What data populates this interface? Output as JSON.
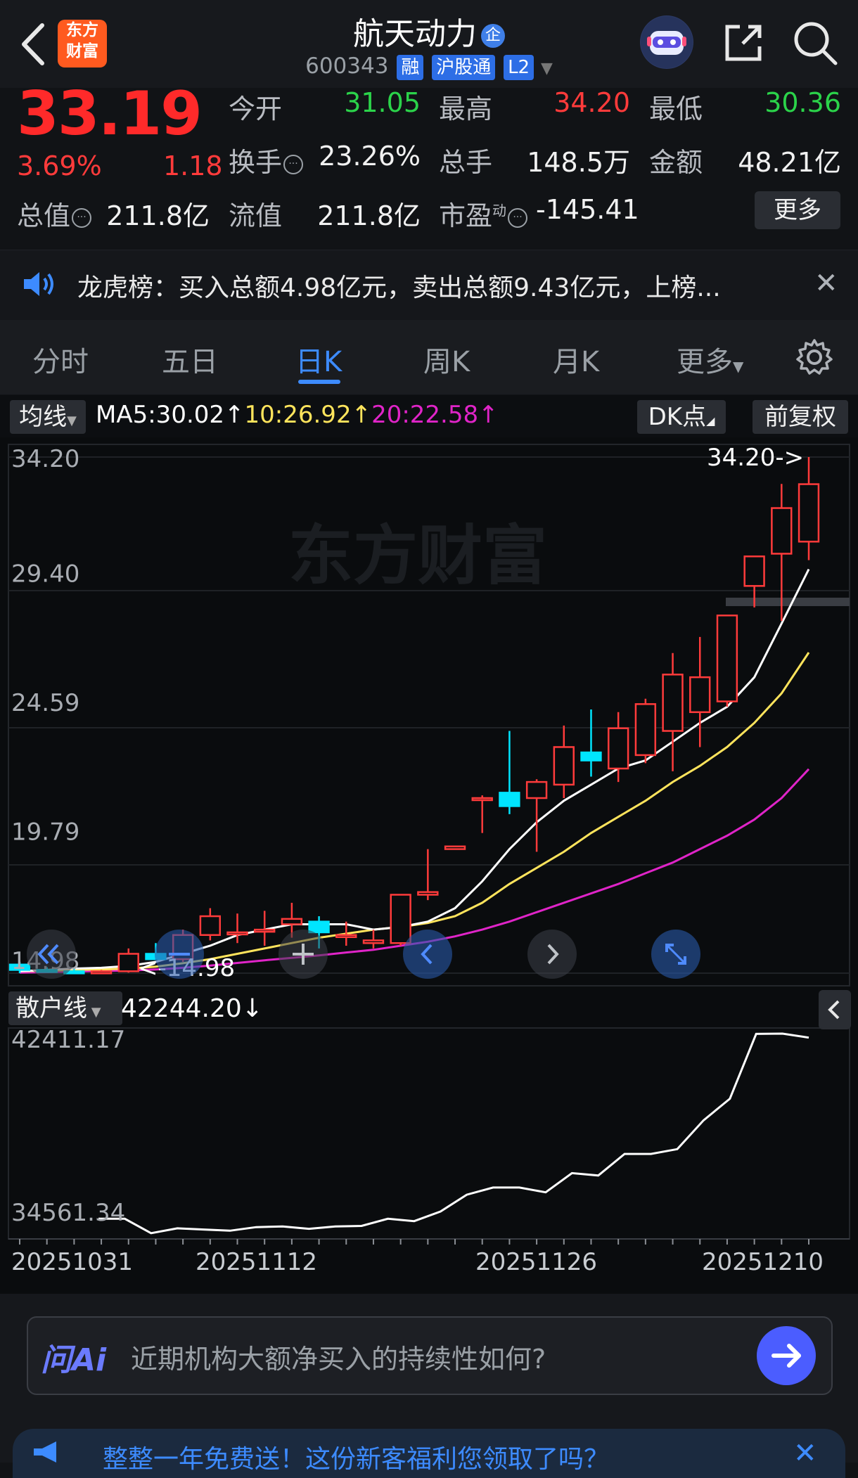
{
  "header": {
    "stock_name": "航天动力",
    "badge": "企",
    "code": "600343",
    "tags": [
      "融",
      "沪股通",
      "L2"
    ]
  },
  "quote": {
    "price": "33.19",
    "change_pct": "3.69%",
    "change": "1.18",
    "fields": [
      {
        "label": "今开",
        "value": "31.05",
        "color": "green"
      },
      {
        "label": "最高",
        "value": "34.20",
        "color": "red"
      },
      {
        "label": "最低",
        "value": "30.36",
        "color": "green"
      },
      {
        "label": "换手",
        "value": "23.26%",
        "color": "white"
      },
      {
        "label": "总手",
        "value": "148.5万",
        "color": "white"
      },
      {
        "label": "金额",
        "value": "48.21亿",
        "color": "white"
      },
      {
        "label": "总值",
        "value": "211.8亿",
        "color": "white"
      },
      {
        "label": "流值",
        "value": "211.8亿",
        "color": "white"
      },
      {
        "label": "市盈",
        "value": "-145.41",
        "color": "white"
      }
    ],
    "pe_superscript": "动",
    "more_label": "更多"
  },
  "news": {
    "text": "龙虎榜：买入总额4.98亿元，卖出总额9.43亿元，上榜..."
  },
  "tabs": [
    "分时",
    "五日",
    "日K",
    "周K",
    "月K",
    "更多"
  ],
  "active_tab": "日K",
  "ma_row": {
    "selector": "均线",
    "ma5": "MA5:30.02↑",
    "ma10": "10:26.92↑",
    "ma20": "20:22.58↑",
    "dk_label": "DK点",
    "adjust_label": "前复权"
  },
  "colors": {
    "up": "#ff3b3b",
    "down": "#00e5ff",
    "ma5": "#ffffff",
    "ma10": "#ffe45c",
    "ma20": "#e024c8",
    "accent": "#3d8bff"
  },
  "chart_data": [
    {
      "type": "candlestick",
      "title": "",
      "y_ticks": [
        "34.20",
        "29.40",
        "24.59",
        "19.79",
        "14.98"
      ],
      "ylim": [
        14.98,
        34.2
      ],
      "x_labels": [
        "20251031",
        "20251112",
        "20251126",
        "20251210"
      ],
      "annotations": {
        "high": "34.20->",
        "low": "<-14.98"
      },
      "candles": [
        {
          "o": 15.3,
          "h": 15.4,
          "l": 14.98,
          "c": 15.1
        },
        {
          "o": 15.1,
          "h": 15.2,
          "l": 15.0,
          "c": 15.05
        },
        {
          "o": 15.05,
          "h": 15.15,
          "l": 14.95,
          "c": 15.0
        },
        {
          "o": 15.0,
          "h": 15.1,
          "l": 14.95,
          "c": 15.05
        },
        {
          "o": 15.05,
          "h": 15.9,
          "l": 15.0,
          "c": 15.7
        },
        {
          "o": 15.7,
          "h": 16.1,
          "l": 15.5,
          "c": 15.5
        },
        {
          "o": 15.5,
          "h": 16.6,
          "l": 15.4,
          "c": 16.4
        },
        {
          "o": 16.4,
          "h": 17.4,
          "l": 16.2,
          "c": 17.1
        },
        {
          "o": 16.5,
          "h": 17.2,
          "l": 16.1,
          "c": 16.5
        },
        {
          "o": 16.6,
          "h": 17.3,
          "l": 16.0,
          "c": 16.6
        },
        {
          "o": 16.8,
          "h": 17.6,
          "l": 16.3,
          "c": 17.0
        },
        {
          "o": 16.9,
          "h": 17.1,
          "l": 15.9,
          "c": 16.5
        },
        {
          "o": 16.4,
          "h": 16.9,
          "l": 16.0,
          "c": 16.4
        },
        {
          "o": 16.1,
          "h": 16.6,
          "l": 15.9,
          "c": 16.2
        },
        {
          "o": 16.1,
          "h": 17.9,
          "l": 16.0,
          "c": 17.9
        },
        {
          "o": 17.9,
          "h": 19.6,
          "l": 17.7,
          "c": 18.0
        },
        {
          "o": 19.6,
          "h": 19.7,
          "l": 19.6,
          "c": 19.7
        },
        {
          "o": 21.5,
          "h": 21.6,
          "l": 20.2,
          "c": 21.5
        },
        {
          "o": 21.7,
          "h": 24.0,
          "l": 20.9,
          "c": 21.2
        },
        {
          "o": 21.5,
          "h": 22.2,
          "l": 19.5,
          "c": 22.1
        },
        {
          "o": 22.0,
          "h": 24.2,
          "l": 21.5,
          "c": 23.4
        },
        {
          "o": 23.2,
          "h": 24.8,
          "l": 22.3,
          "c": 22.9
        },
        {
          "o": 22.6,
          "h": 24.7,
          "l": 22.1,
          "c": 24.1
        },
        {
          "o": 23.1,
          "h": 25.2,
          "l": 22.8,
          "c": 25.0
        },
        {
          "o": 24.0,
          "h": 26.9,
          "l": 22.5,
          "c": 26.1
        },
        {
          "o": 24.7,
          "h": 27.5,
          "l": 23.4,
          "c": 26.0
        },
        {
          "o": 25.1,
          "h": 28.3,
          "l": 24.9,
          "c": 28.3
        },
        {
          "o": 29.4,
          "h": 29.7,
          "l": 28.6,
          "c": 30.5
        },
        {
          "o": 30.6,
          "h": 33.2,
          "l": 28.1,
          "c": 32.3
        },
        {
          "o": 31.05,
          "h": 34.2,
          "l": 30.36,
          "c": 33.19
        }
      ],
      "ma5": [
        15.05,
        15.1,
        15.15,
        15.18,
        15.25,
        15.4,
        15.7,
        16.0,
        16.4,
        16.6,
        16.8,
        16.8,
        16.8,
        16.6,
        16.7,
        16.9,
        17.4,
        18.4,
        19.6,
        20.6,
        21.4,
        22.0,
        22.6,
        22.9,
        23.6,
        24.3,
        24.9,
        26.0,
        28.0,
        30.02
      ],
      "ma10": [
        15.05,
        15.07,
        15.1,
        15.12,
        15.15,
        15.22,
        15.35,
        15.5,
        15.7,
        15.9,
        16.1,
        16.3,
        16.45,
        16.6,
        16.7,
        16.85,
        17.1,
        17.6,
        18.3,
        18.9,
        19.5,
        20.2,
        20.8,
        21.4,
        22.1,
        22.7,
        23.4,
        24.3,
        25.4,
        26.92
      ],
      "ma20": [
        15.0,
        15.02,
        15.04,
        15.06,
        15.08,
        15.12,
        15.18,
        15.26,
        15.36,
        15.46,
        15.55,
        15.64,
        15.75,
        15.85,
        16.0,
        16.15,
        16.35,
        16.6,
        16.9,
        17.25,
        17.6,
        17.95,
        18.3,
        18.7,
        19.1,
        19.6,
        20.1,
        20.7,
        21.5,
        22.58
      ]
    },
    {
      "type": "line",
      "title": "散户线",
      "current": "42244.20↓",
      "y_ticks": [
        "42411.17",
        "34561.34"
      ],
      "ylim": [
        34561.34,
        42411.17
      ],
      "values": [
        34700,
        34700,
        34100,
        34300,
        34250,
        34200,
        34350,
        34380,
        34280,
        34380,
        34400,
        34700,
        34600,
        35000,
        35700,
        36000,
        36000,
        35800,
        36600,
        36500,
        37400,
        37400,
        37600,
        38800,
        39700,
        42400,
        42411.17,
        42244.2
      ]
    }
  ],
  "indicator": {
    "selector": "散户线",
    "current": "42244.20↓"
  },
  "ai": {
    "label": "问Ai",
    "placeholder": "近期机构大额净买入的持续性如何?"
  },
  "promo": {
    "text": "整整一年免费送！这份新客福利您领取了吗？"
  },
  "watermark": "东方财富",
  "logo_text": [
    "东方",
    "财富"
  ]
}
